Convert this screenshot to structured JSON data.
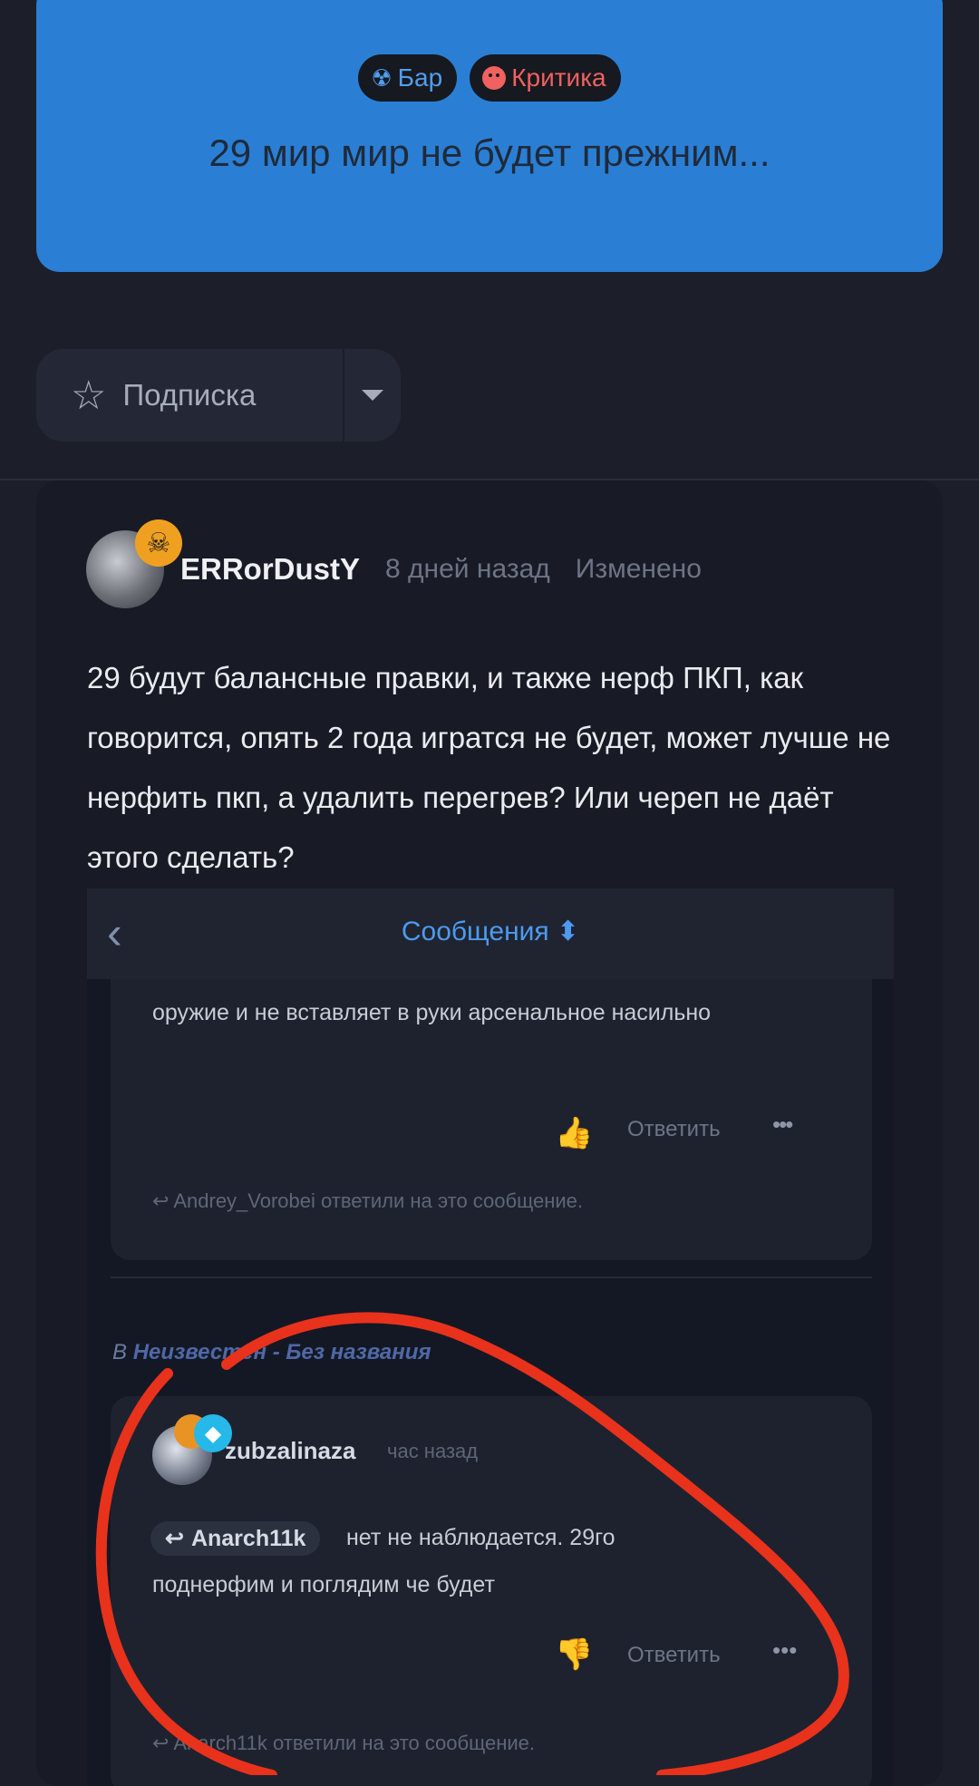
{
  "banner": {
    "tags": [
      {
        "icon": "radiation-icon",
        "label": "Бар",
        "color": "#4f9ef0"
      },
      {
        "icon": "sad-face-icon",
        "label": "Критика",
        "color": "#f06160"
      }
    ],
    "title": "29 мир мир не будет прежним..."
  },
  "subscribe": {
    "label": "Подписка",
    "icon": "star-icon"
  },
  "post": {
    "author": "ERRorDustY",
    "time": "8 дней назад",
    "edited": "Изменено",
    "text": "29 будут балансные правки, и также нерф ПКП, как говорится, опять 2 года игратся не будет, может лучше не нерфить пкп, а удалить перегрев? Или череп не даёт этого сделать?"
  },
  "screenshot": {
    "header_title": "Сообщения ⬍",
    "message1": {
      "text": "оружие и не вставляет в руки арсенальное насильно",
      "reply_label": "Ответить",
      "more": "•••",
      "replied_note": "Andrey_Vorobei ответили на это сообщение."
    },
    "location_prefix": "В",
    "location": "Неизвестен - Без названия",
    "message2": {
      "author": "zubzalinaza",
      "time": "час назад",
      "mention": "Anarch11k",
      "text_line1": "нет не наблюдается. 29го",
      "text_line2": "поднерфим и поглядим че будет",
      "reply_label": "Ответить",
      "more": "•••",
      "replied_note": "Anarch11k ответили на это сообщение."
    }
  },
  "colors": {
    "background": "#1c1f2a",
    "banner": "#2a7fd4",
    "accent": "#4d9af0",
    "annotation": "#e8321c"
  }
}
